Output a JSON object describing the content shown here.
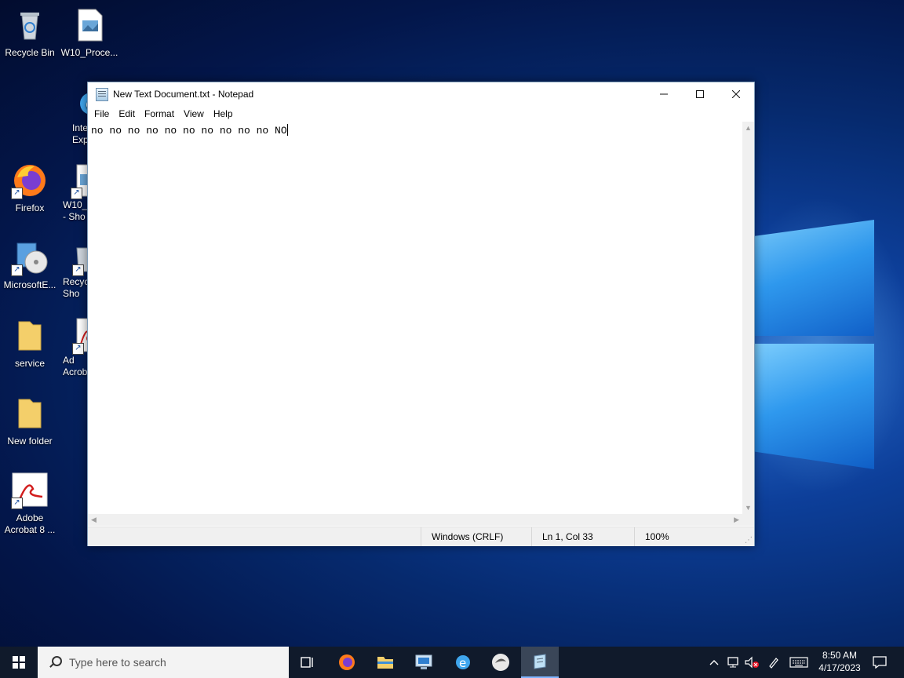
{
  "desktop": {
    "icons": [
      {
        "label": "Recycle Bin"
      },
      {
        "label": "W10_Proce..."
      },
      {
        "label": "Inte\nExp"
      },
      {
        "label": "Firefox"
      },
      {
        "label": "W10_F\n- Sho"
      },
      {
        "label": "MicrosoftE..."
      },
      {
        "label": "Recyc\nSho"
      },
      {
        "label": "service"
      },
      {
        "label": "Ad\nAcrob"
      },
      {
        "label": "New folder"
      },
      {
        "label": "Adobe\nAcrobat 8 ..."
      }
    ]
  },
  "notepad": {
    "title": "New Text Document.txt - Notepad",
    "menu": [
      "File",
      "Edit",
      "Format",
      "View",
      "Help"
    ],
    "content": "no no no no no no no no no no NO",
    "status": {
      "line_ending": "Windows (CRLF)",
      "position": "Ln 1, Col 33",
      "zoom": "100%"
    }
  },
  "taskbar": {
    "search_placeholder": "Type here to search",
    "time": "8:50 AM",
    "date": "4/17/2023"
  },
  "colors": {
    "taskbar": "#101a2b",
    "accent": "#7fb4ff"
  }
}
